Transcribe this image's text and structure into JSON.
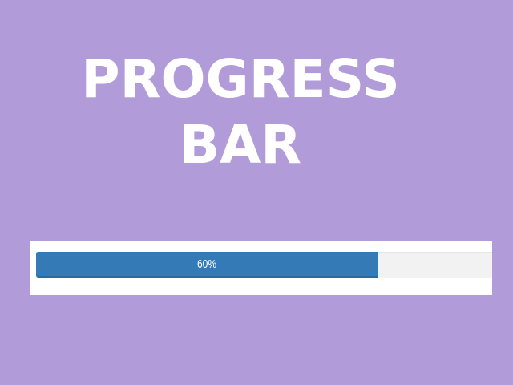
{
  "colors": {
    "background": "#b19cd9",
    "title_text": "#ffffff",
    "panel": "#ffffff",
    "track": "#f2f2f2",
    "fill": "#337ab7"
  },
  "title": {
    "line1": "PROGRESS",
    "line2": "BAR"
  },
  "progress": {
    "value": 0.6,
    "label": "60%"
  }
}
